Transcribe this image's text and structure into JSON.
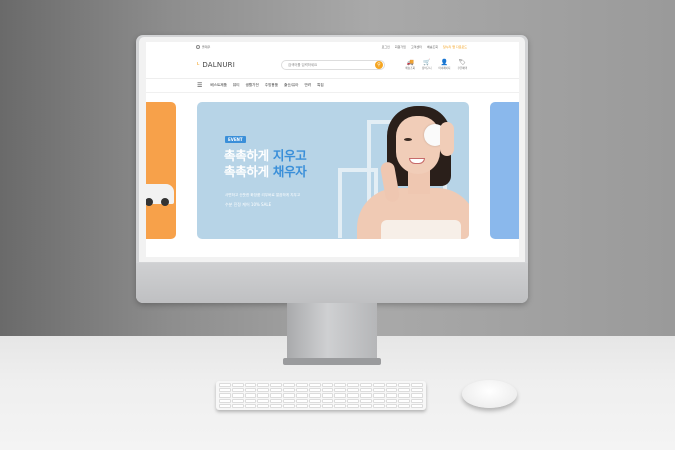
{
  "topbar": {
    "brand_link": "을재쿠",
    "links": [
      "로그인",
      "회원가입",
      "고객센터",
      "배송조회"
    ],
    "highlight_link": "달누리 앱 다운로드",
    "accent_color": "#f39c12"
  },
  "header": {
    "logo": "DALNURI",
    "search_placeholder": "검색어를 입력하세요",
    "icons": [
      {
        "name": "truck-icon",
        "glyph": "🚚",
        "label": "배송조회"
      },
      {
        "name": "cart-icon",
        "glyph": "🛒",
        "label": "장바구니"
      },
      {
        "name": "user-icon",
        "glyph": "👤",
        "label": "마이페이지"
      },
      {
        "name": "tag-icon",
        "glyph": "🏷",
        "label": "쿠폰혜택"
      }
    ]
  },
  "nav": {
    "items": [
      "베스트제품",
      "뷰티",
      "생활가전",
      "주방용품",
      "출산/유아",
      "반려",
      "특집"
    ]
  },
  "banner": {
    "badge": "EVENT",
    "line1_white": "촉촉하게",
    "line1_accent": "지우고",
    "line2_white": "촉촉하게",
    "line2_accent": "채우자",
    "sub1": "사면하고 산뜻한 화장품 리무버로 깔끔하게 지우고",
    "sub2": "수분 진정 케어 10% SALE",
    "accent_color": "#3a8fd9",
    "background_color": "#b7d4e7"
  }
}
